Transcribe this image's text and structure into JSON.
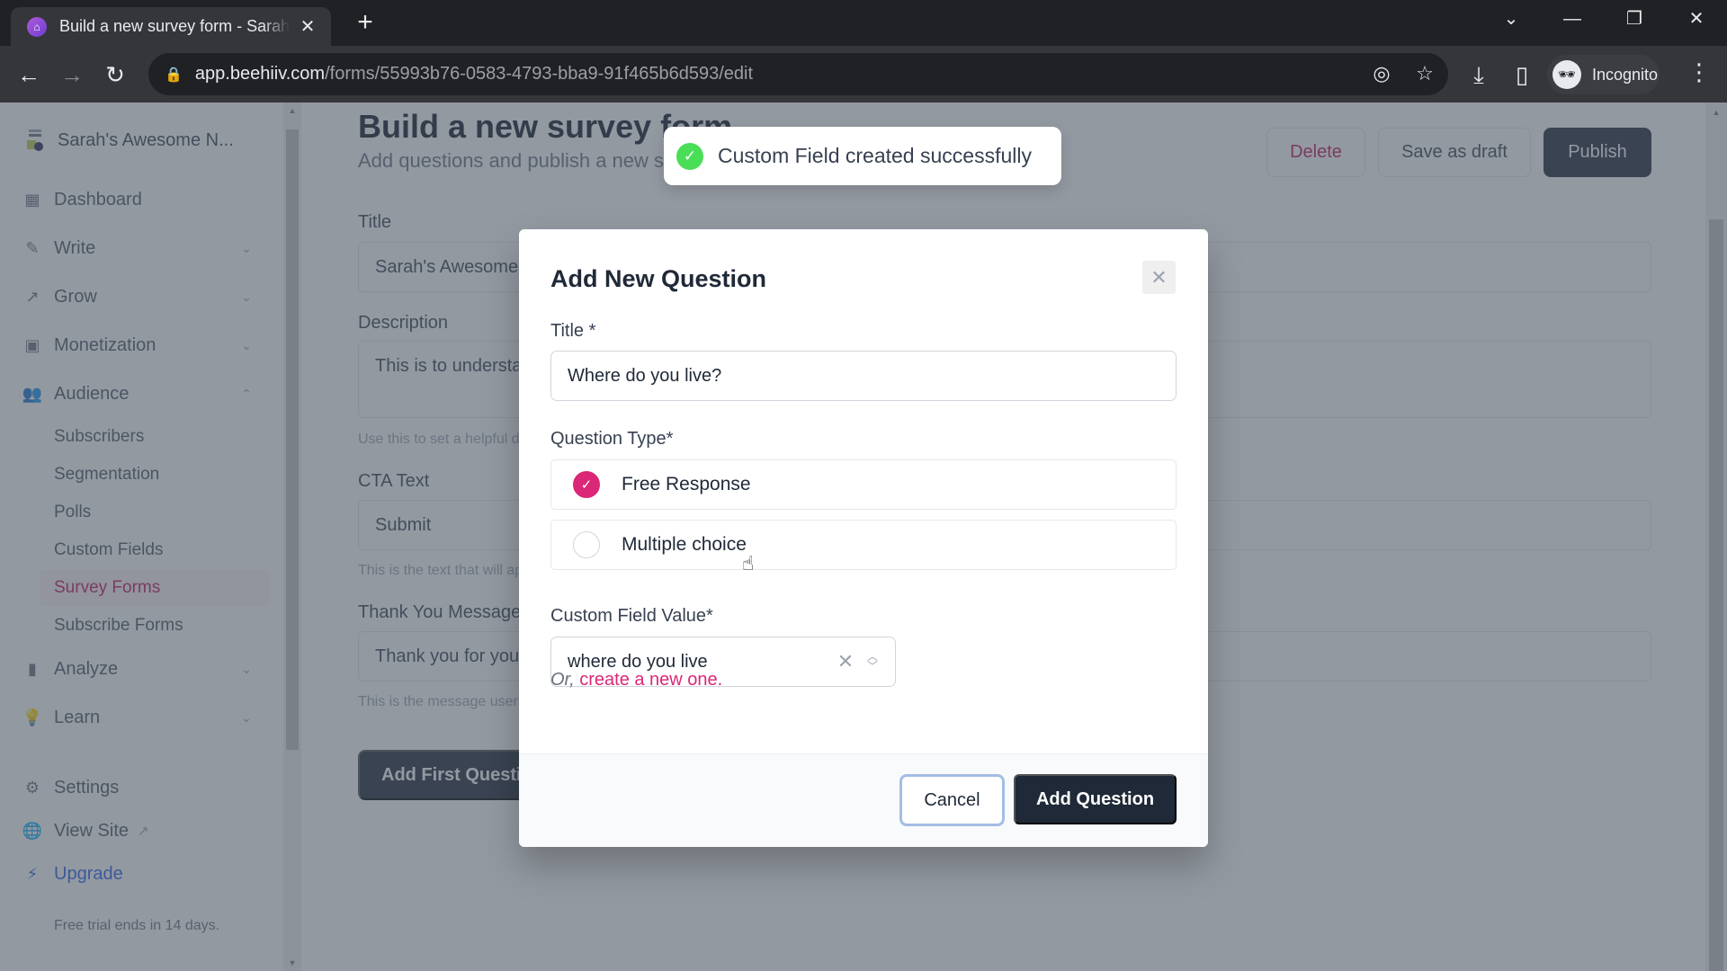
{
  "browser": {
    "tab_title": "Build a new survey form - Sarah's Awesome Newsletter",
    "tab_close": "✕",
    "new_tab": "+",
    "url_host": "app.beehiiv.com",
    "url_path": "/forms/55993b76-0583-4793-bba9-91f465b6d593/edit",
    "profile_label": "Incognito",
    "icons": {
      "back": "←",
      "forward": "→",
      "reload": "↻",
      "lock": "🔒",
      "eye_off": "◎",
      "star": "☆",
      "download": "⤓",
      "sidepanel": "▯",
      "incognito": "🕶",
      "menu": "⋮",
      "tab_search": "⌄",
      "minimize": "—",
      "restore": "❐",
      "close": "✕"
    }
  },
  "sidebar": {
    "publication": "Sarah's Awesome N...",
    "items": [
      {
        "label": "Dashboard",
        "icon": "▦",
        "chevron": ""
      },
      {
        "label": "Write",
        "icon": "✎",
        "chevron": "⌄"
      },
      {
        "label": "Grow",
        "icon": "↗",
        "chevron": "⌄"
      },
      {
        "label": "Monetization",
        "icon": "▣",
        "chevron": "⌄"
      },
      {
        "label": "Audience",
        "icon": "👥",
        "chevron": "⌃"
      }
    ],
    "audience_sub": [
      "Subscribers",
      "Segmentation",
      "Polls",
      "Custom Fields",
      "Survey Forms",
      "Subscribe Forms"
    ],
    "active_sub": "Survey Forms",
    "items_after": [
      {
        "label": "Analyze",
        "icon": "▮",
        "chevron": "⌄"
      },
      {
        "label": "Learn",
        "icon": "💡",
        "chevron": "⌄"
      }
    ],
    "settings": {
      "label": "Settings",
      "icon": "⚙"
    },
    "view_site": {
      "label": "View Site",
      "icon": "🌐",
      "ext": "↗"
    },
    "upgrade": {
      "label": "Upgrade",
      "icon": "⚡"
    },
    "trial_note": "Free trial ends in 14 days."
  },
  "page": {
    "title": "Build a new survey form",
    "subtitle": "Add questions and publish a new survey form",
    "buttons": {
      "delete": "Delete",
      "save_draft": "Save as draft",
      "publish": "Publish"
    },
    "fields": {
      "title_label": "Title",
      "title_value": "Sarah's Awesome Survey",
      "description_label": "Description",
      "description_value": "This is to understand our readers better",
      "description_help": "Use this to set a helpful description",
      "cta_label": "CTA Text",
      "cta_value": "Submit",
      "cta_help": "This is the text that will appear on the submit button",
      "thanks_label": "Thank You Message",
      "thanks_value": "Thank you for your response",
      "thanks_help": "This is the message users will see after submitting"
    },
    "add_first_question": "Add First Question"
  },
  "toast": {
    "message": "Custom Field created successfully",
    "icon": "✓",
    "color": "#4ade56"
  },
  "modal": {
    "title": "Add New Question",
    "close": "✕",
    "title_label": "Title *",
    "title_value": "Where do you live?",
    "question_type_label": "Question Type*",
    "question_types": [
      {
        "label": "Free Response",
        "checked": true
      },
      {
        "label": "Multiple choice",
        "checked": false
      }
    ],
    "custom_field_label": "Custom Field Value*",
    "custom_field_value": "where do you live",
    "or_text": "Or,",
    "create_link": "create a new one.",
    "cancel": "Cancel",
    "submit": "Add Question",
    "accent_color": "#db2777"
  }
}
